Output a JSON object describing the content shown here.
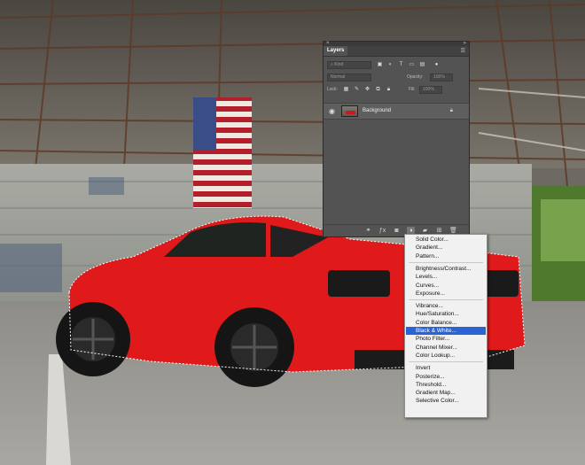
{
  "panel": {
    "tab_label": "Layers",
    "kind_filter": "Kind",
    "blend_mode": "Normal",
    "opacity_label": "Opacity:",
    "opacity_value": "100%",
    "lock_label": "Lock:",
    "fill_label": "Fill:",
    "fill_value": "100%",
    "layer_name": "Background"
  },
  "adjustment_menu": {
    "groups": [
      [
        "Solid Color...",
        "Gradient...",
        "Pattern..."
      ],
      [
        "Brightness/Contrast...",
        "Levels...",
        "Curves...",
        "Exposure..."
      ],
      [
        "Vibrance...",
        "Hue/Saturation...",
        "Color Balance...",
        "Black & White...",
        "Photo Filter...",
        "Channel Mixer...",
        "Color Lookup..."
      ],
      [
        "Invert",
        "Posterize...",
        "Threshold...",
        "Gradient Map...",
        "Selective Color..."
      ]
    ],
    "selected_item": "Black & White...",
    "selected_color": "#2a63d4"
  },
  "colors": {
    "car_red": "#e01a1a",
    "panel_bg": "#535353"
  }
}
